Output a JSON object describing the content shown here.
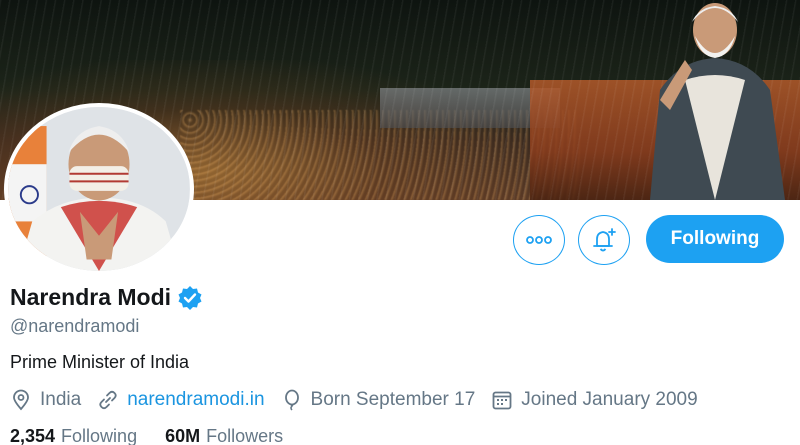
{
  "profile": {
    "name": "Narendra Modi",
    "handle": "@narendramodi",
    "bio": "Prime Minister of India",
    "location": "India",
    "website": "narendramodi.in",
    "born": "Born September 17",
    "joined": "Joined January 2009"
  },
  "actions": {
    "more_icon": "more-horizontal-icon",
    "notify_icon": "bell-plus-icon",
    "follow_label": "Following"
  },
  "stats": {
    "following_count": "2,354",
    "following_label": "Following",
    "followers_count": "60M",
    "followers_label": "Followers"
  },
  "colors": {
    "accent": "#1da1f2",
    "link": "#1b95e0",
    "muted": "#657786",
    "text": "#14171a"
  },
  "icons": {
    "verified": "verified-badge-icon",
    "location": "location-pin-icon",
    "website": "link-icon",
    "born": "balloon-icon",
    "joined": "calendar-icon"
  }
}
